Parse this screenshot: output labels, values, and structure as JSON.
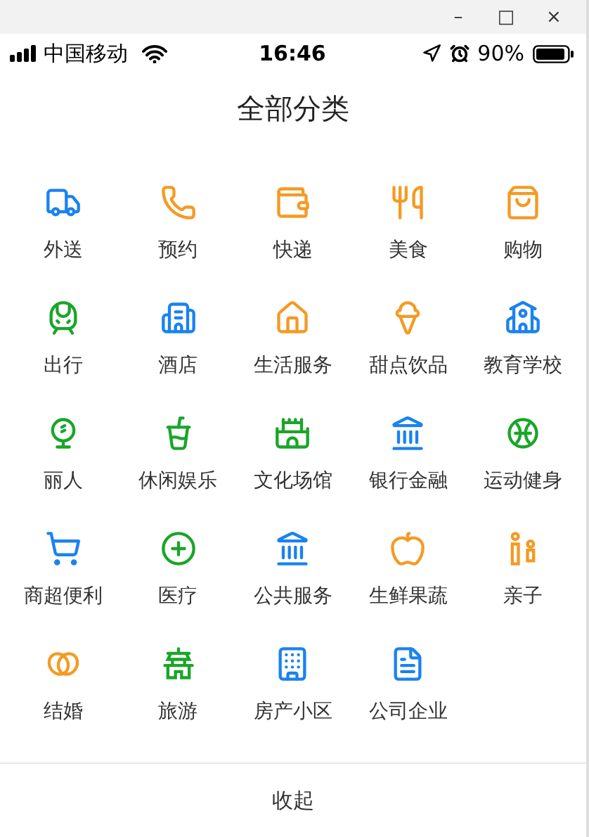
{
  "window_controls": [
    "–",
    "□",
    "×"
  ],
  "status_bar": {
    "carrier": "中国移动",
    "time": "16:46",
    "battery": "90%"
  },
  "title": "全部分类",
  "categories": [
    {
      "label": "外送",
      "color": "#1a82f0"
    },
    {
      "label": "预约",
      "color": "#f59a23"
    },
    {
      "label": "快递",
      "color": "#f59a23"
    },
    {
      "label": "美食",
      "color": "#f59a23"
    },
    {
      "label": "购物",
      "color": "#f59a23"
    },
    {
      "label": "出行",
      "color": "#1aa52a"
    },
    {
      "label": "酒店",
      "color": "#1a82f0"
    },
    {
      "label": "生活服务",
      "color": "#f59a23"
    },
    {
      "label": "甜点饮品",
      "color": "#f59a23"
    },
    {
      "label": "教育学校",
      "color": "#1a82f0"
    },
    {
      "label": "丽人",
      "color": "#1aa52a"
    },
    {
      "label": "休闲娱乐",
      "color": "#1aa52a"
    },
    {
      "label": "文化场馆",
      "color": "#1aa52a"
    },
    {
      "label": "银行金融",
      "color": "#1a82f0"
    },
    {
      "label": "运动健身",
      "color": "#1aa52a"
    },
    {
      "label": "商超便利",
      "color": "#1a82f0"
    },
    {
      "label": "医疗",
      "color": "#1aa52a"
    },
    {
      "label": "公共服务",
      "color": "#1a82f0"
    },
    {
      "label": "生鲜果蔬",
      "color": "#f59a23"
    },
    {
      "label": "亲子",
      "color": "#f59a23"
    },
    {
      "label": "结婚",
      "color": "#f59a23"
    },
    {
      "label": "旅游",
      "color": "#1aa52a"
    },
    {
      "label": "房产小区",
      "color": "#1a82f0"
    },
    {
      "label": "公司企业",
      "color": "#1a82f0"
    }
  ],
  "collapse_button": "收起"
}
